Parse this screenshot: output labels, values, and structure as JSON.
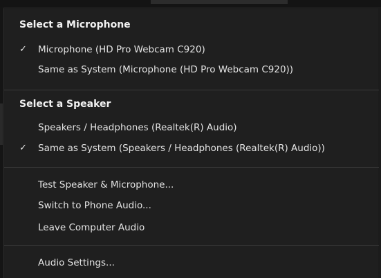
{
  "microphone_section": {
    "heading": "Select a Microphone",
    "items": [
      {
        "label": "Microphone (HD Pro Webcam C920)",
        "checked": true
      },
      {
        "label": "Same as System (Microphone (HD Pro Webcam C920))",
        "checked": false
      }
    ]
  },
  "speaker_section": {
    "heading": "Select a Speaker",
    "items": [
      {
        "label": "Speakers / Headphones (Realtek(R) Audio)",
        "checked": false
      },
      {
        "label": "Same as System (Speakers / Headphones (Realtek(R) Audio))",
        "checked": true
      }
    ]
  },
  "actions": {
    "test": "Test Speaker & Microphone...",
    "phone": "Switch to Phone Audio...",
    "leave": "Leave Computer Audio"
  },
  "settings": {
    "label": "Audio Settings..."
  },
  "check_glyph": "✓"
}
